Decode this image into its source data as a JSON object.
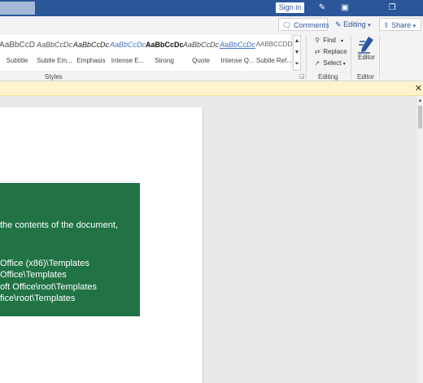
{
  "titlebar": {
    "signin_label": "Sign in",
    "icons": [
      "pen-icon",
      "ribbon-display-icon",
      "restore-icon"
    ]
  },
  "commands": {
    "comments_label": "Comments",
    "editing_label": "Editing",
    "share_label": "Share"
  },
  "ribbon": {
    "styles": [
      {
        "preview": "AaBbCcD",
        "name": "Subtitle"
      },
      {
        "preview": "AaBbCcDc",
        "name": "Subtle Em..."
      },
      {
        "preview": "AaBbCcDc",
        "name": "Emphasis"
      },
      {
        "preview": "AaBbCcDc",
        "name": "Intense E..."
      },
      {
        "preview": "AaBbCcDc",
        "name": "Strong"
      },
      {
        "preview": "AaBbCcDc",
        "name": "Quote"
      },
      {
        "preview": "AaBbCcDc",
        "name": "Intense Q..."
      },
      {
        "preview": "AABBCCDD",
        "name": "Subtle Ref..."
      }
    ],
    "styles_group_label": "Styles",
    "editing": {
      "find_label": "Find",
      "replace_label": "Replace",
      "select_label": "Select",
      "group_label": "Editing"
    },
    "editor": {
      "label": "Editor",
      "group_label": "Editor"
    }
  },
  "document": {
    "green_box": {
      "lines": [
        "the contents of the document,",
        "Office (x86)\\Templates",
        "Office\\Templates",
        "oft Office\\root\\Templates",
        "fice\\root\\Templates"
      ]
    }
  },
  "colors": {
    "titlebar": "#2b579a",
    "green_box": "#217346",
    "message_bar": "#fff4ce"
  }
}
